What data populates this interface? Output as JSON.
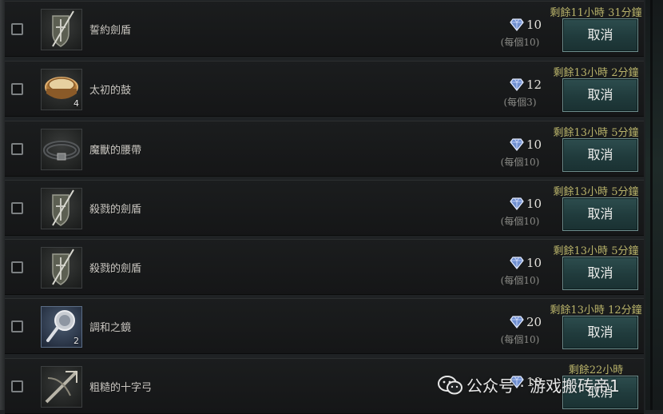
{
  "listings": [
    {
      "name": "誓約劍盾",
      "price": "10",
      "unit_price": "(每個10)",
      "time_left": "剩餘11小時 31分鐘",
      "cancel_label": "取消",
      "quantity": "",
      "icon": "shield-sword-icon",
      "frame": "dark"
    },
    {
      "name": "太初的鼓",
      "price": "12",
      "unit_price": "(每個3)",
      "time_left": "剩餘13小時 2分鐘",
      "cancel_label": "取消",
      "quantity": "4",
      "icon": "drum-icon",
      "frame": "dark"
    },
    {
      "name": "魔獸的腰帶",
      "price": "10",
      "unit_price": "(每個10)",
      "time_left": "剩餘13小時 5分鐘",
      "cancel_label": "取消",
      "quantity": "",
      "icon": "belt-icon",
      "frame": "dark"
    },
    {
      "name": "殺戮的劍盾",
      "price": "10",
      "unit_price": "(每個10)",
      "time_left": "剩餘13小時 5分鐘",
      "cancel_label": "取消",
      "quantity": "",
      "icon": "shield-sword-icon",
      "frame": "dark"
    },
    {
      "name": "殺戮的劍盾",
      "price": "10",
      "unit_price": "(每個10)",
      "time_left": "剩餘13小時 5分鐘",
      "cancel_label": "取消",
      "quantity": "",
      "icon": "shield-sword-icon",
      "frame": "dark"
    },
    {
      "name": "調和之鏡",
      "price": "20",
      "unit_price": "(每個10)",
      "time_left": "剩餘13小時 12分鐘",
      "cancel_label": "取消",
      "quantity": "2",
      "icon": "mirror-icon",
      "frame": "blue"
    },
    {
      "name": "粗糙的十字弓",
      "price": "10",
      "unit_price": "",
      "time_left": "剩餘22小時",
      "cancel_label": "取消",
      "quantity": "",
      "icon": "crossbow-icon",
      "frame": "dark"
    }
  ],
  "watermark": {
    "text": "公众号 · 游戏搬砖帝1",
    "icon": "wechat-icon"
  },
  "colors": {
    "time_text": "#b9b36a",
    "button_bg": "#203b3c",
    "gem": "#9ab6e8"
  }
}
